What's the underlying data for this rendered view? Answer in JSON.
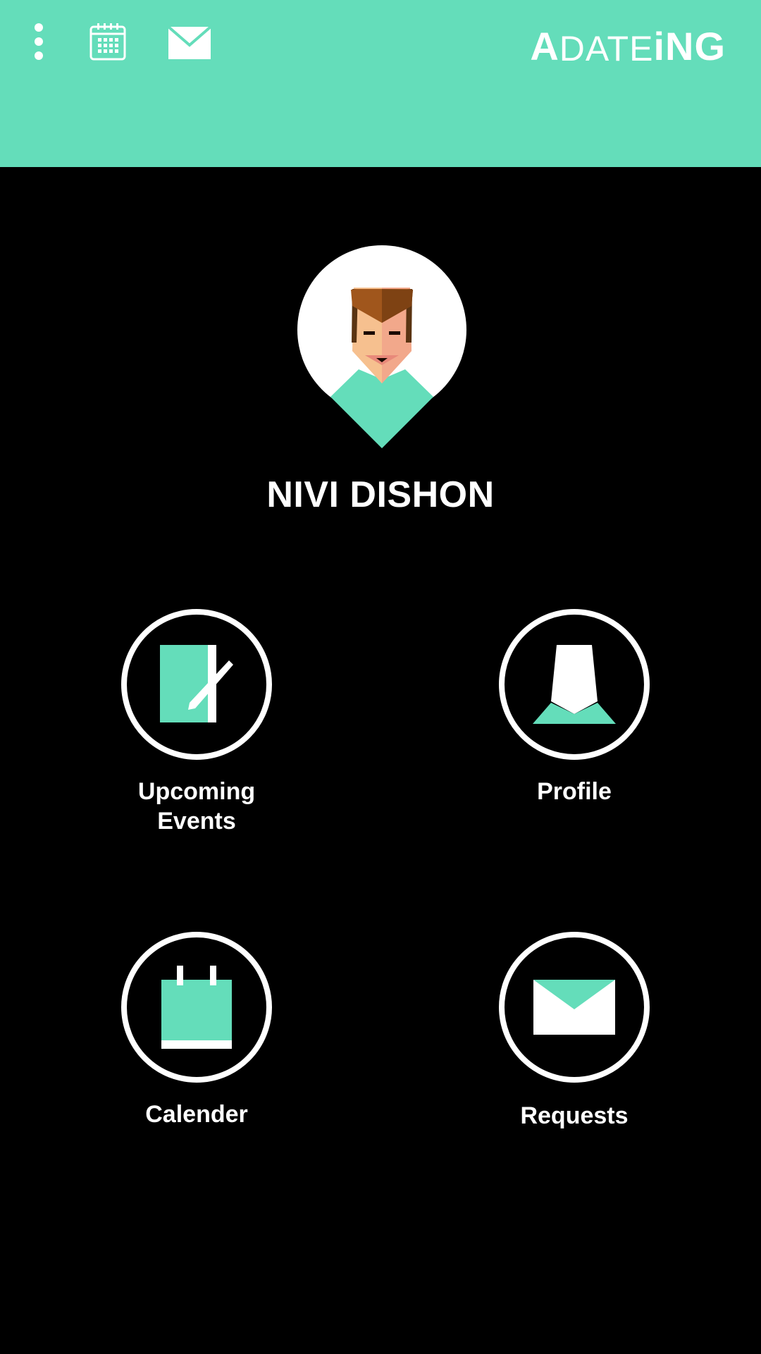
{
  "header": {
    "logo_prefix": "A",
    "logo_middle": "DATE",
    "logo_suffix": "iNG",
    "background": "#64ddba",
    "icons": [
      "more-vert-icon",
      "calendar-icon",
      "mail-icon"
    ]
  },
  "user": {
    "name": "NIVI DISHON"
  },
  "menu": [
    {
      "label_line1": "Upcoming",
      "label_line2": "Events",
      "icon": "event-note-icon"
    },
    {
      "label": "Profile",
      "icon": "profile-icon"
    },
    {
      "label": "Calender",
      "icon": "calendar-icon"
    },
    {
      "label": "Requests",
      "icon": "mail-icon"
    }
  ],
  "colors": {
    "accent": "#64ddba",
    "background": "#000000",
    "foreground": "#ffffff"
  }
}
